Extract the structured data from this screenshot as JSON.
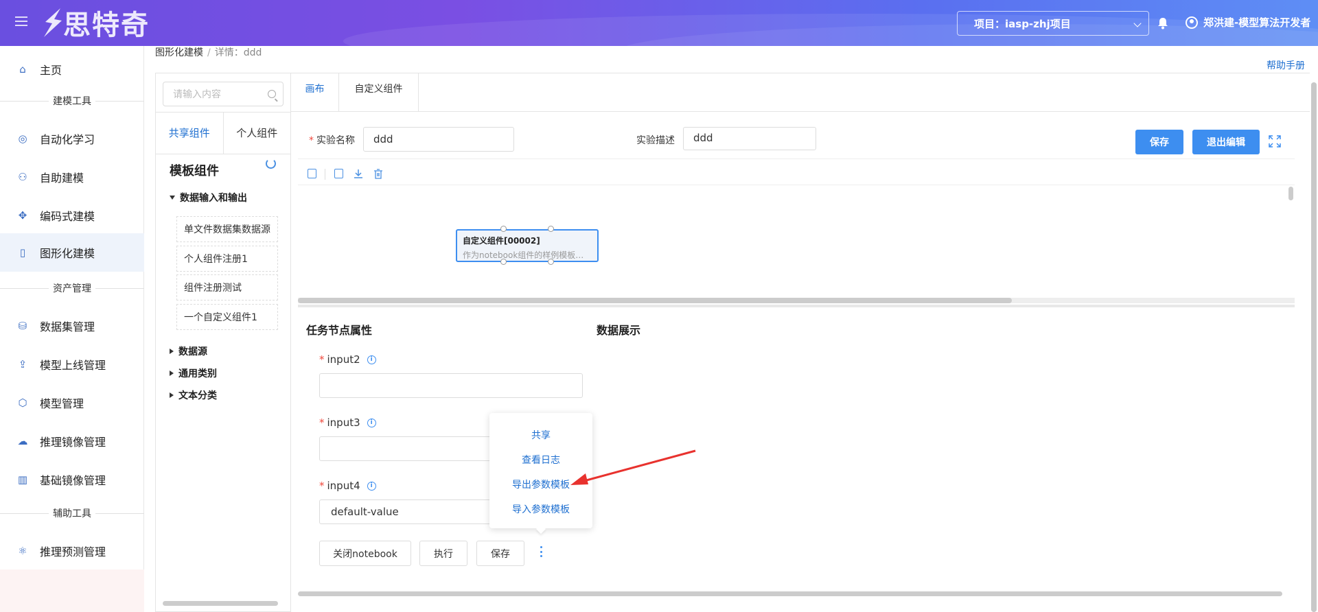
{
  "header": {
    "logo_text": "思特奇",
    "project_label": "项目：iasp-zhj项目",
    "user_label": "郑洪建-模型算法开发者"
  },
  "sidebar": {
    "home": "主页",
    "group1": "建模工具",
    "items1": [
      "自动化学习",
      "自助建模",
      "编码式建模",
      "图形化建模"
    ],
    "group2": "资产管理",
    "items2": [
      "数据集管理",
      "模型上线管理",
      "模型管理",
      "推理镜像管理",
      "基础镜像管理"
    ],
    "group3": "辅助工具",
    "items3": [
      "推理预测管理"
    ]
  },
  "breadcrumb": {
    "root": "图形化建模",
    "sep": "/",
    "current": "详情：ddd"
  },
  "help_link": "帮助手册",
  "component_panel": {
    "search_placeholder": "请输入内容",
    "tab_shared": "共享组件",
    "tab_personal": "个人组件",
    "template_title": "模板组件",
    "folder_io": "数据输入和输出",
    "leaves": [
      "单文件数据集数据源",
      "个人组件注册1",
      "组件注册测试",
      "一个自定义组件1"
    ],
    "folder_datasource": "数据源",
    "folder_general": "通用类别",
    "folder_text": "文本分类"
  },
  "main_tabs": {
    "canvas": "画布",
    "custom": "自定义组件"
  },
  "experiment": {
    "name_label": "实验名称",
    "name_value": "ddd",
    "desc_label": "实验描述",
    "desc_value": "ddd",
    "save": "保存",
    "exit_edit": "退出编辑"
  },
  "node": {
    "title": "自定义组件[00002]",
    "desc": "作为notebook组件的样例模板，开..."
  },
  "properties": {
    "title": "任务节点属性",
    "data_title": "数据展示",
    "input2_label": "input2",
    "input2_value": "",
    "input3_label": "input3",
    "input3_value": "",
    "input4_label": "input4",
    "input4_value": "default-value",
    "btn_close_notebook": "关闭notebook",
    "btn_run": "执行",
    "btn_save": "保存"
  },
  "dropdown": {
    "items": [
      "共享",
      "查看日志",
      "导出参数模板",
      "导入参数模板"
    ]
  },
  "colors": {
    "primary": "#3d8ef0",
    "link": "#1e6fd0",
    "required": "#f04a3e",
    "arrow": "#e8322e"
  }
}
